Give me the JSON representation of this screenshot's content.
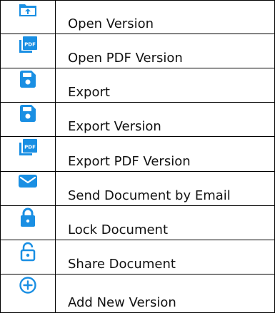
{
  "accent_color": "#1a8fe3",
  "menu": {
    "items": [
      {
        "icon": "folder-upload-icon",
        "label": "Open Version"
      },
      {
        "icon": "pdf-file-icon",
        "label": "Open PDF Version"
      },
      {
        "icon": "floppy-disk-icon",
        "label": "Export"
      },
      {
        "icon": "floppy-disk-icon",
        "label": "Export Version"
      },
      {
        "icon": "pdf-file-icon",
        "label": "Export PDF Version"
      },
      {
        "icon": "envelope-icon",
        "label": "Send Document by Email"
      },
      {
        "icon": "lock-closed-icon",
        "label": "Lock Document"
      },
      {
        "icon": "lock-open-icon",
        "label": "Share Document"
      },
      {
        "icon": "plus-circle-icon",
        "label": "Add New Version"
      }
    ]
  }
}
